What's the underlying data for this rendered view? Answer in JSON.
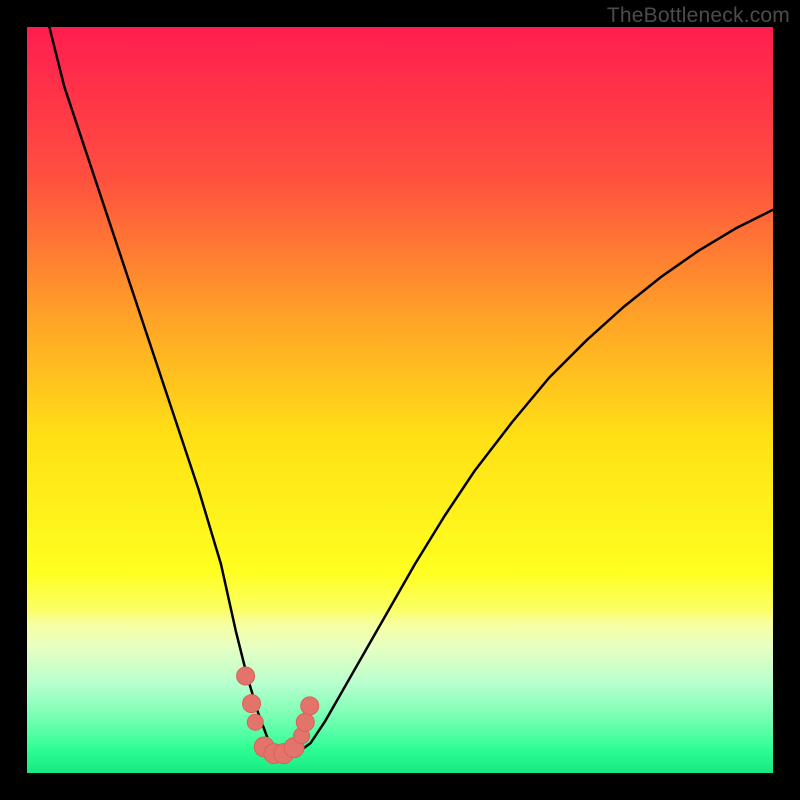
{
  "watermark": "TheBottleneck.com",
  "colors": {
    "frame_bg": "#000000",
    "gradient_stops": [
      {
        "pos": 0,
        "color": "#ff1d4f"
      },
      {
        "pos": 0.2,
        "color": "#ff4f3f"
      },
      {
        "pos": 0.4,
        "color": "#ffa726"
      },
      {
        "pos": 0.55,
        "color": "#ffe015"
      },
      {
        "pos": 0.73,
        "color": "#ffff20"
      },
      {
        "pos": 0.78,
        "color": "#fbff62"
      },
      {
        "pos": 0.8,
        "color": "#f7ffa0"
      },
      {
        "pos": 0.83,
        "color": "#e8ffc2"
      },
      {
        "pos": 0.88,
        "color": "#b8ffcf"
      },
      {
        "pos": 0.93,
        "color": "#70ffb0"
      },
      {
        "pos": 0.97,
        "color": "#2bfd93"
      },
      {
        "pos": 1.0,
        "color": "#18e882"
      }
    ],
    "curve": "#000000",
    "marker_fill": "#e2746b",
    "marker_stroke": "#d86258"
  },
  "chart_data": {
    "type": "line",
    "title": "",
    "xlabel": "",
    "ylabel": "",
    "xlim": [
      0,
      100
    ],
    "ylim": [
      0,
      100
    ],
    "grid": false,
    "series": [
      {
        "name": "bottleneck-curve",
        "x": [
          3,
          5,
          8,
          11,
          14,
          17,
          20,
          23,
          26,
          28,
          29.5,
          31,
          32.5,
          34,
          36,
          38,
          40,
          44,
          48,
          52,
          56,
          60,
          65,
          70,
          75,
          80,
          85,
          90,
          95,
          100
        ],
        "y": [
          100,
          92,
          83,
          74,
          65,
          56,
          47,
          38,
          28,
          19,
          13,
          8,
          4,
          2.5,
          2.5,
          4,
          7,
          14,
          21,
          28,
          34.5,
          40.5,
          47,
          53,
          58,
          62.5,
          66.5,
          70,
          73,
          75.5
        ]
      }
    ],
    "markers": {
      "name": "highlighted-points",
      "x": [
        29.3,
        30.1,
        30.6,
        31.8,
        33.1,
        34.4,
        35.8,
        36.8,
        37.3,
        37.9
      ],
      "y": [
        13.0,
        9.3,
        6.8,
        3.5,
        2.6,
        2.6,
        3.4,
        5.0,
        6.8,
        9.0
      ],
      "r": [
        9,
        9,
        8,
        10,
        10,
        10,
        10,
        8,
        9,
        9
      ]
    }
  }
}
